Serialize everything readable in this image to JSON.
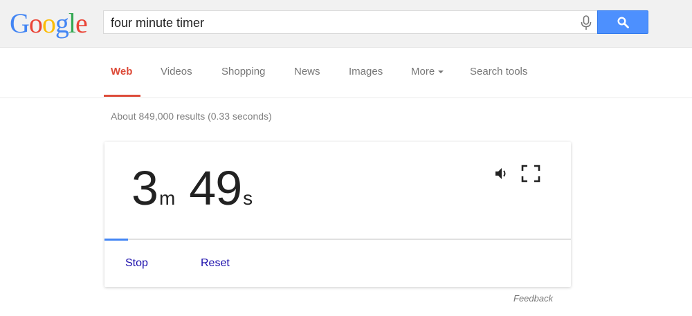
{
  "logo": {
    "letters": [
      "G",
      "o",
      "o",
      "g",
      "l",
      "e"
    ],
    "colors": [
      "#4285f4",
      "#ea4335",
      "#fbbc05",
      "#4285f4",
      "#34a853",
      "#ea4335"
    ]
  },
  "search": {
    "query": "four minute timer",
    "icons": {
      "mic": "microphone-icon",
      "submit": "search-icon"
    }
  },
  "nav": {
    "tabs": [
      {
        "label": "Web",
        "active": true
      },
      {
        "label": "Videos"
      },
      {
        "label": "Shopping"
      },
      {
        "label": "News"
      },
      {
        "label": "Images"
      },
      {
        "label": "More"
      },
      {
        "label": "Search tools"
      }
    ]
  },
  "results": {
    "stats": "About 849,000 results (0.33 seconds)"
  },
  "timer": {
    "minutes": "3",
    "minutes_unit": "m",
    "seconds": "49",
    "seconds_unit": "s",
    "progress_fraction": 0.05,
    "stop_label": "Stop",
    "reset_label": "Reset",
    "icons": {
      "sound": "speaker-icon",
      "fullscreen": "fullscreen-icon"
    }
  },
  "feedback": "Feedback",
  "colors": {
    "header_bg": "#f1f1f1",
    "search_button": "#4d90fe",
    "active_tab": "#dd4b39",
    "link": "#1a0dab",
    "progress": "#4285f4"
  }
}
